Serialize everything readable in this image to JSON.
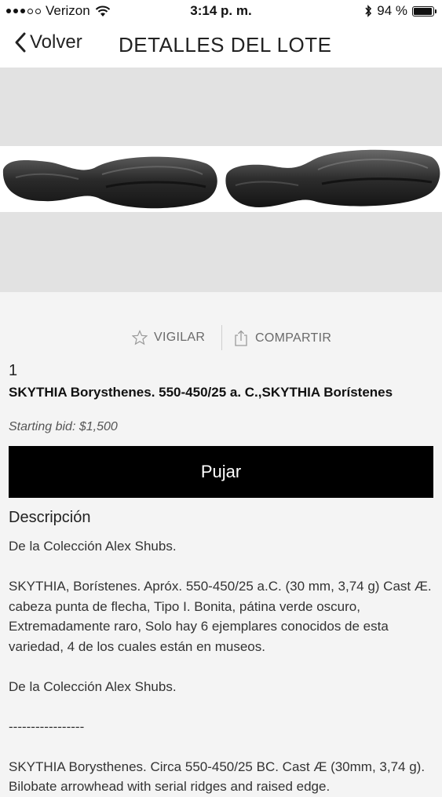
{
  "status": {
    "carrier": "Verizon",
    "time": "3:14 p. m.",
    "battery_pct": "94 %",
    "battery_level": 0.94
  },
  "nav": {
    "back_label": "Volver",
    "title": "DETALLES DEL LOTE"
  },
  "actions": {
    "watch_label": "VIGILAR",
    "share_label": "COMPARTIR"
  },
  "lot": {
    "number": "1",
    "title": "SKYTHIA Borysthenes. 550-450/25 a. C.,SKYTHIA Borístenes",
    "starting_bid": "Starting bid: $1,500",
    "bid_button": "Pujar"
  },
  "description": {
    "heading": "Descripción",
    "p1": "De la Colección Alex Shubs.",
    "p2": "SKYTHIA, Borístenes. Apróx. 550-450/25 a.C. (30 mm, 3,74 g) Cast Æ. cabeza punta de flecha, Tipo I. Bonita, pátina verde oscuro, Extremadamente raro, Solo hay 6 ejemplares conocidos de esta variedad, 4 de los cuales están en museos.",
    "p3": "De la Colección Alex Shubs.",
    "separator": "-----------------",
    "p4": "SKYTHIA Borysthenes. Circa 550-450/25 BC. Cast Æ (30mm, 3,74 g). Bilobate arrowhead with serial ridges and raised edge."
  },
  "colors": {
    "button_bg": "#000000",
    "button_text": "#ffffff",
    "image_bg": "#e2e2e2",
    "page_bg": "#f4f4f4"
  }
}
